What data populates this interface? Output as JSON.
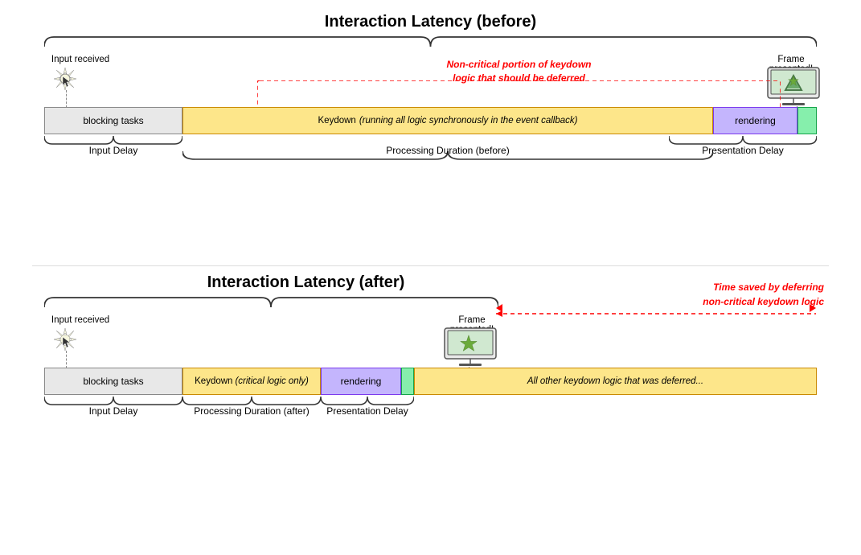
{
  "top": {
    "title": "Interaction Latency (before)",
    "input_received": "Input received",
    "frame_presented": "Frame presented!",
    "red_annotation_line1": "Non-critical portion of keydown",
    "red_annotation_line2": "logic that should be deferred",
    "bar_blocking": "blocking tasks",
    "bar_keydown": "Keydown (running all logic synchronously in the event callback)",
    "bar_rendering": "rendering",
    "label_input_delay": "Input Delay",
    "label_processing": "Processing Duration (before)",
    "label_presentation": "Presentation Delay"
  },
  "bottom": {
    "title": "Interaction Latency (after)",
    "input_received": "Input received",
    "frame_presented": "Frame presented!",
    "time_saved_line1": "Time saved by deferring",
    "time_saved_line2": "non-critical keydown logic",
    "bar_blocking": "blocking tasks",
    "bar_keydown": "Keydown (critical logic only)",
    "bar_rendering": "rendering",
    "bar_deferred": "All other keydown logic that was deferred...",
    "label_input_delay": "Input Delay",
    "label_processing": "Processing Duration (after)",
    "label_presentation": "Presentation Delay"
  }
}
